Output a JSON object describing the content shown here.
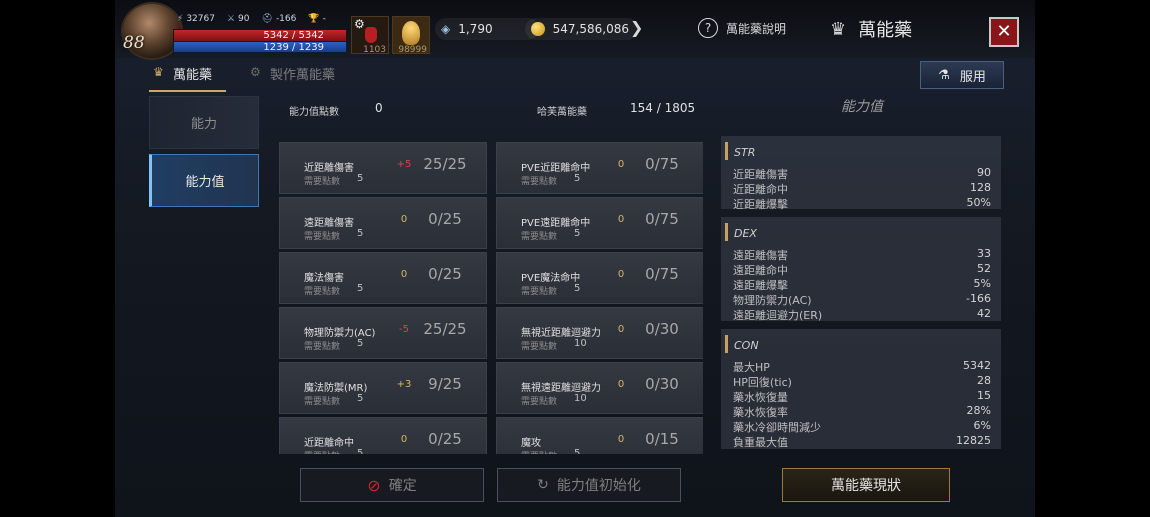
{
  "player": {
    "level": "88",
    "power": "32767",
    "attack": "90",
    "defense": "-166",
    "trophy": "-",
    "hp": "5342 / 5342",
    "mp": "1239 / 1239"
  },
  "quick_slots": [
    {
      "icon": "potion-icon",
      "count": "1103"
    },
    {
      "icon": "gold-feather-icon",
      "count": "98999"
    }
  ],
  "currency": {
    "gems": "1,790",
    "gold": "547,586,086"
  },
  "header": {
    "help_label": "萬能藥說明",
    "title": "萬能藥",
    "close_icon": "close-icon"
  },
  "tabs": [
    {
      "label": "萬能藥",
      "active": true
    },
    {
      "label": "製作萬能藥",
      "active": false
    }
  ],
  "use_button": "服用",
  "sidebar": [
    {
      "label": "能力",
      "active": false
    },
    {
      "label": "能力值",
      "active": true
    }
  ],
  "points": {
    "label": "能力值點數",
    "value": "0",
    "used_label": "哈芙萬能藥",
    "used_value": "154 / 1805"
  },
  "required_label": "需要點數",
  "cards": [
    {
      "name": "近距離傷害",
      "delta": "+5",
      "progress": "25/25",
      "required": "5"
    },
    {
      "name": "PVE近距離命中",
      "delta": "0",
      "progress": "0/75",
      "required": "5"
    },
    {
      "name": "遠距離傷害",
      "delta": "0",
      "progress": "0/25",
      "required": "5"
    },
    {
      "name": "PVE遠距離命中",
      "delta": "0",
      "progress": "0/75",
      "required": "5"
    },
    {
      "name": "魔法傷害",
      "delta": "0",
      "progress": "0/25",
      "required": "5"
    },
    {
      "name": "PVE魔法命中",
      "delta": "0",
      "progress": "0/75",
      "required": "5"
    },
    {
      "name": "物理防禦力(AC)",
      "delta": "-5",
      "progress": "25/25",
      "required": "5"
    },
    {
      "name": "無視近距離迴避力",
      "delta": "0",
      "progress": "0/30",
      "required": "10"
    },
    {
      "name": "魔法防禦(MR)",
      "delta": "+3",
      "progress": "9/25",
      "required": "5"
    },
    {
      "name": "無視遠距離迴避力",
      "delta": "0",
      "progress": "0/30",
      "required": "10"
    },
    {
      "name": "近距離命中",
      "delta": "0",
      "progress": "0/25",
      "required": "5"
    },
    {
      "name": "魔攻",
      "delta": "0",
      "progress": "0/15",
      "required": "5"
    }
  ],
  "stat_panel": {
    "title": "能力值",
    "groups": [
      {
        "name": "STR",
        "rows": [
          {
            "k": "近距離傷害",
            "v": "90"
          },
          {
            "k": "近距離命中",
            "v": "128"
          },
          {
            "k": "近距離爆擊",
            "v": "50%"
          }
        ]
      },
      {
        "name": "DEX",
        "rows": [
          {
            "k": "遠距離傷害",
            "v": "33"
          },
          {
            "k": "遠距離命中",
            "v": "52"
          },
          {
            "k": "遠距離爆擊",
            "v": "5%"
          },
          {
            "k": "物理防禦力(AC)",
            "v": "-166"
          },
          {
            "k": "遠距離迴避力(ER)",
            "v": "42"
          }
        ]
      },
      {
        "name": "CON",
        "rows": [
          {
            "k": "最大HP",
            "v": "5342"
          },
          {
            "k": "HP回復(tic)",
            "v": "28"
          },
          {
            "k": "藥水恢復量",
            "v": "15"
          },
          {
            "k": "藥水恢復率",
            "v": "28%"
          },
          {
            "k": "藥水冷卻時間減少",
            "v": "6%"
          },
          {
            "k": "負重最大值",
            "v": "12825"
          }
        ]
      }
    ]
  },
  "bottom": {
    "confirm": "確定",
    "reset": "能力值初始化",
    "status": "萬能藥現狀"
  }
}
